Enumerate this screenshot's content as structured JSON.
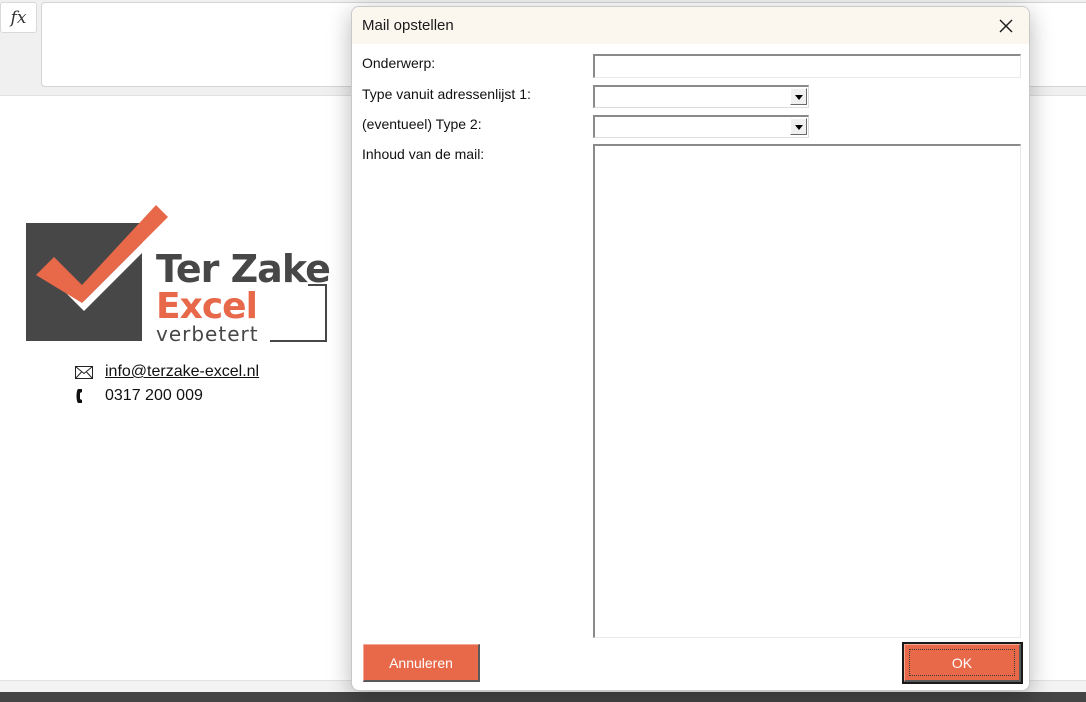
{
  "formula_bar": {
    "fx_label": "fx"
  },
  "sheet": {
    "logo": {
      "line1": "Ter Zake",
      "line2": "Excel",
      "line3": "verbetert"
    },
    "contact": {
      "email": "info@terzake-excel.nl",
      "phone": "0317 200 009"
    }
  },
  "dialog": {
    "title": "Mail opstellen",
    "fields": {
      "subject_label": "Onderwerp:",
      "subject_value": "",
      "type1_label": "Type vanuit adressenlijst 1:",
      "type1_value": "",
      "type2_label": "(eventueel) Type 2:",
      "type2_value": "",
      "body_label": "Inhoud van de mail:",
      "body_value": ""
    },
    "buttons": {
      "cancel_label": "Annuleren",
      "ok_label": "OK"
    }
  },
  "colors": {
    "accent": "#e8694a",
    "logo_gray": "#474747"
  }
}
